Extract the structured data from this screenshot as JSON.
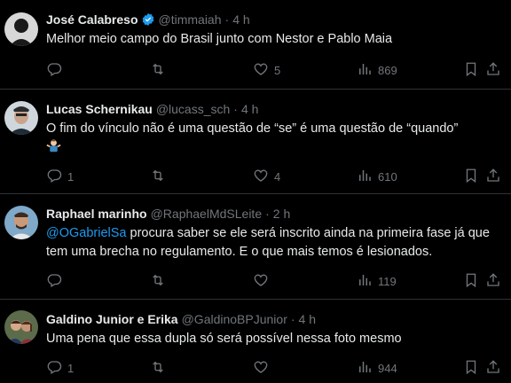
{
  "colors": {
    "background": "#000000",
    "text": "#e7e9ea",
    "muted": "#71767b",
    "link": "#1d9bf0",
    "divider": "#2f3336"
  },
  "tweets": [
    {
      "name": "José Calabreso",
      "verified": true,
      "handle": "@timmaiah",
      "time": "4 h",
      "text": "Melhor meio campo do Brasil junto com Nestor e Pablo Maia",
      "replies": "",
      "retweets": "",
      "likes": "5",
      "views": "869"
    },
    {
      "name": "Lucas Schernikau",
      "verified": false,
      "handle": "@lucass_sch",
      "time": "4 h",
      "text": "O fim do vínculo não é uma questão de “se” é uma questão de “quando”",
      "emoji": "man-shrugging-emoji",
      "replies": "1",
      "retweets": "",
      "likes": "4",
      "views": "610"
    },
    {
      "name": "Raphael marinho",
      "verified": false,
      "handle": "@RaphaelMdSLeite",
      "time": "2 h",
      "mention": "@OGabrielSa",
      "text": " procura saber se ele será inscrito ainda na primeira fase já que tem uma brecha no regulamento. E o que mais temos é lesionados.",
      "replies": "",
      "retweets": "",
      "likes": "",
      "views": "119"
    },
    {
      "name": "Galdino Junior e Erika",
      "verified": false,
      "handle": "@GaldinoBPJunior",
      "time": "4 h",
      "text": "Uma pena que essa dupla só será possível nessa foto mesmo",
      "replies": "1",
      "retweets": "",
      "likes": "",
      "views": "944"
    }
  ],
  "icons": {
    "reply": "reply-icon",
    "retweet": "retweet-icon",
    "like": "heart-icon",
    "views": "views-chart-icon",
    "bookmark": "bookmark-icon",
    "share": "share-icon"
  }
}
